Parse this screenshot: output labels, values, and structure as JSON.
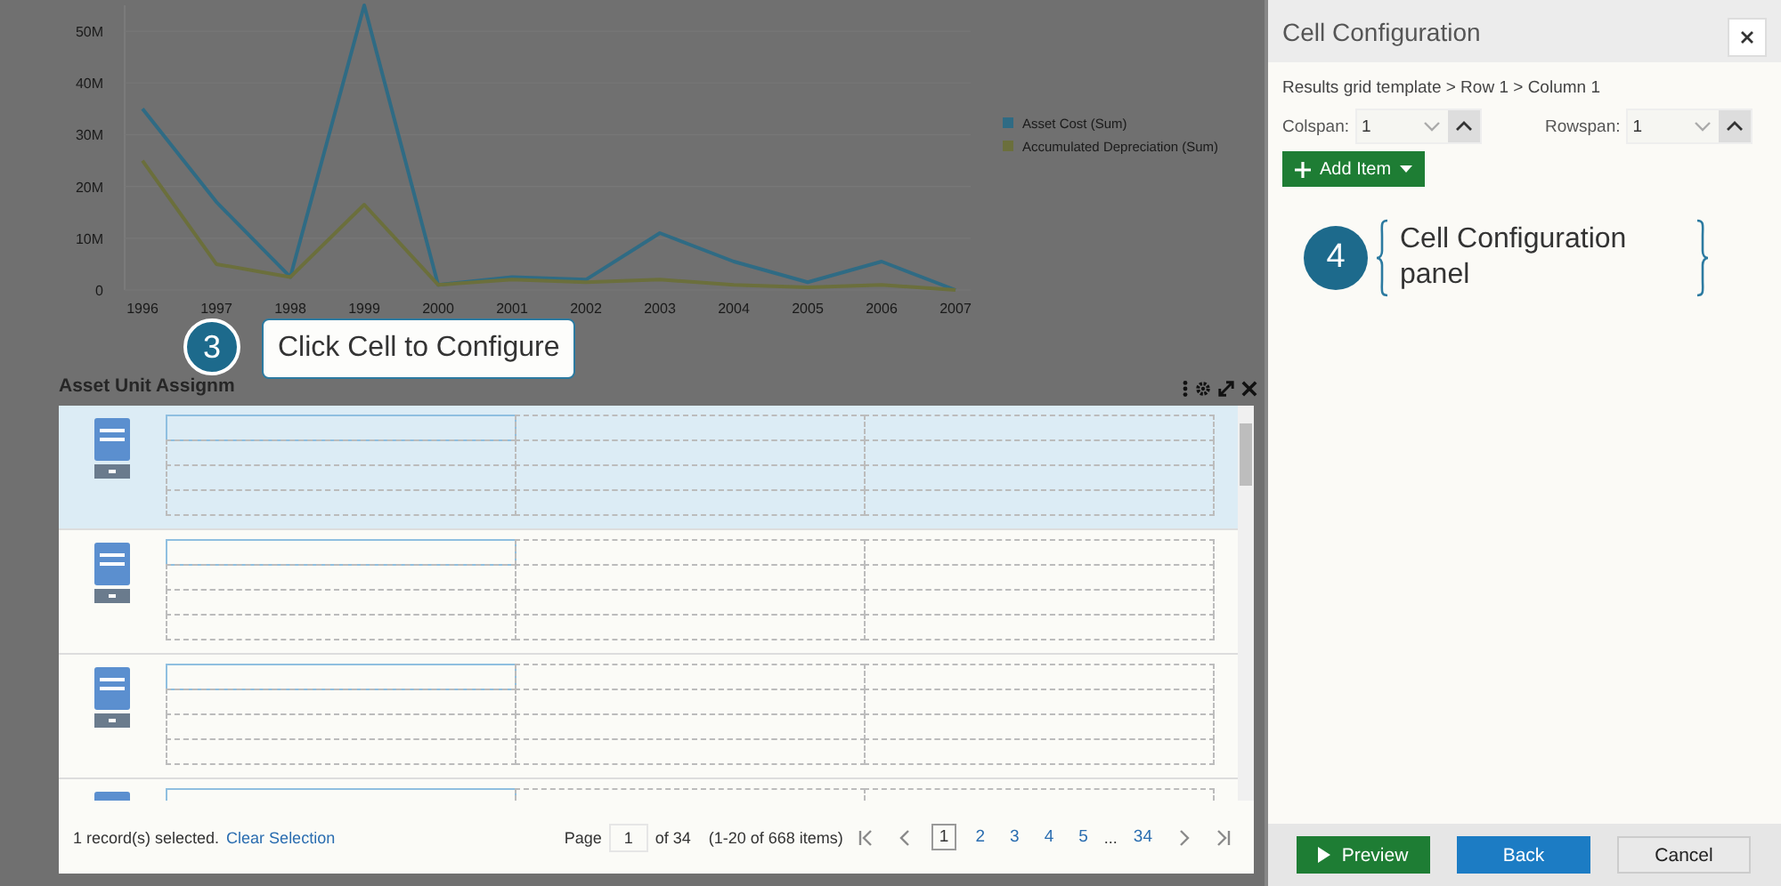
{
  "chart": {
    "chart_data": {
      "type": "line",
      "categories": [
        "1996",
        "1997",
        "1998",
        "1999",
        "2000",
        "2001",
        "2002",
        "2003",
        "2004",
        "2005",
        "2006",
        "2007"
      ],
      "series": [
        {
          "name": "Asset Cost (Sum)",
          "color": "#2f6b84",
          "values": [
            35,
            17,
            2.5,
            55,
            1,
            2.5,
            2,
            11,
            5.5,
            1.5,
            5.5,
            0
          ]
        },
        {
          "name": "Accumulated Depreciation (Sum)",
          "color": "#6b6f3c",
          "values": [
            25,
            5,
            2.5,
            16.5,
            1,
            2,
            1.5,
            2,
            1,
            0.5,
            1,
            0
          ]
        }
      ],
      "ylim": [
        0,
        55
      ],
      "legend": "right",
      "yticks": [
        {
          "value": 0,
          "label": "0"
        },
        {
          "value": 10,
          "label": "10M"
        },
        {
          "value": 20,
          "label": "20M"
        },
        {
          "value": 30,
          "label": "30M"
        },
        {
          "value": 40,
          "label": "40M"
        },
        {
          "value": 50,
          "label": "50M"
        }
      ]
    }
  },
  "grid_panel": {
    "title": "Asset Unit Assignm",
    "rows": [
      {
        "selected": true
      },
      {
        "selected": false
      },
      {
        "selected": false
      },
      {
        "selected": false
      }
    ],
    "footer": {
      "selection": "1 record(s) selected.",
      "clear_link": "Clear Selection",
      "page_label": "Page",
      "page_value": "1",
      "page_of": "of 34",
      "items": "(1-20 of 668 items)",
      "pages": [
        {
          "label": "1",
          "kind": "page",
          "selected": true
        },
        {
          "label": "2",
          "kind": "page",
          "selected": false
        },
        {
          "label": "3",
          "kind": "page",
          "selected": false
        },
        {
          "label": "4",
          "kind": "page",
          "selected": false
        },
        {
          "label": "5",
          "kind": "page",
          "selected": false
        },
        {
          "label": "...",
          "kind": "ellipsis"
        },
        {
          "label": "34",
          "kind": "page",
          "selected": false
        }
      ]
    }
  },
  "callouts": [
    {
      "number": "3",
      "text": "Click Cell to Configure"
    },
    {
      "number": "4",
      "text": "Cell Configuration panel"
    }
  ],
  "config_panel": {
    "title": "Cell Configuration",
    "breadcrumb": "Results grid template > Row 1 > Column 1",
    "spinners": [
      {
        "label": "Colspan:",
        "value": "1"
      },
      {
        "label": "Rowspan:",
        "value": "1"
      }
    ],
    "add_button": "Add Item",
    "buttons": [
      {
        "label": "Preview",
        "kind": "play"
      },
      {
        "label": "Back",
        "kind": "primary"
      },
      {
        "label": "Cancel",
        "kind": "default"
      }
    ]
  }
}
